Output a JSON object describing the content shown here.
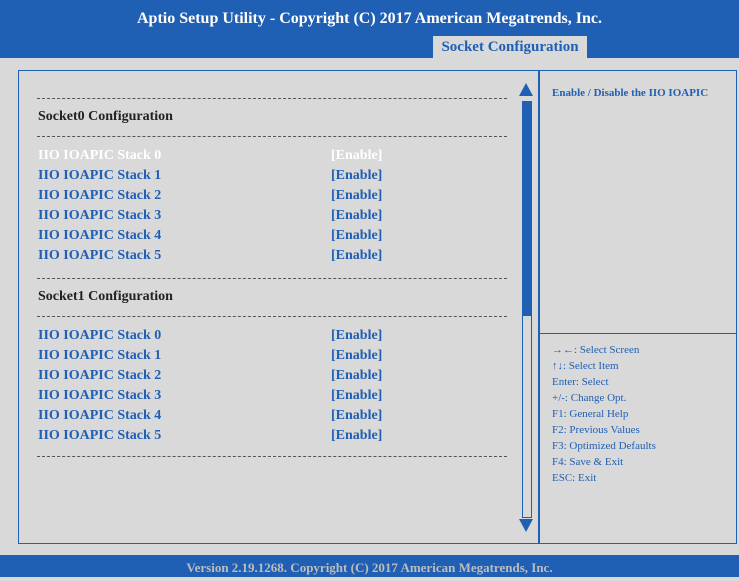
{
  "header": {
    "title": "Aptio Setup Utility - Copyright (C) 2017 American Megatrends, Inc.",
    "active_tab": "Socket Configuration"
  },
  "sections": [
    {
      "title": "Socket0 Configuration",
      "items": [
        {
          "label": "IIO IOAPIC Stack 0",
          "value": "[Enable]",
          "selected": true
        },
        {
          "label": "IIO IOAPIC Stack 1",
          "value": "[Enable]"
        },
        {
          "label": "IIO IOAPIC Stack 2",
          "value": "[Enable]"
        },
        {
          "label": "IIO IOAPIC Stack 3",
          "value": "[Enable]"
        },
        {
          "label": "IIO IOAPIC Stack 4",
          "value": "[Enable]"
        },
        {
          "label": "IIO IOAPIC Stack 5",
          "value": "[Enable]"
        }
      ]
    },
    {
      "title": "Socket1 Configuration",
      "items": [
        {
          "label": "IIO IOAPIC Stack 0",
          "value": "[Enable]"
        },
        {
          "label": "IIO IOAPIC Stack 1",
          "value": "[Enable]"
        },
        {
          "label": "IIO IOAPIC Stack 2",
          "value": "[Enable]"
        },
        {
          "label": "IIO IOAPIC Stack 3",
          "value": "[Enable]"
        },
        {
          "label": "IIO IOAPIC Stack 4",
          "value": "[Enable]"
        },
        {
          "label": "IIO IOAPIC Stack 5",
          "value": "[Enable]"
        }
      ]
    }
  ],
  "help": {
    "text": "Enable / Disable the IIO IOAPIC",
    "keys": [
      "→←: Select Screen",
      "↑↓: Select Item",
      "Enter: Select",
      "+/-: Change Opt.",
      "F1: General Help",
      "F2: Previous Values",
      "F3: Optimized Defaults",
      "F4: Save & Exit",
      "ESC: Exit"
    ]
  },
  "footer": {
    "text": "Version 2.19.1268. Copyright (C) 2017 American Megatrends, Inc."
  },
  "colors": {
    "accent": "#1f5fb4",
    "background": "#d9d9d9",
    "selected_text": "#ffffff"
  },
  "icons": {
    "scroll_up": "triangle-up",
    "scroll_down": "triangle-down"
  }
}
